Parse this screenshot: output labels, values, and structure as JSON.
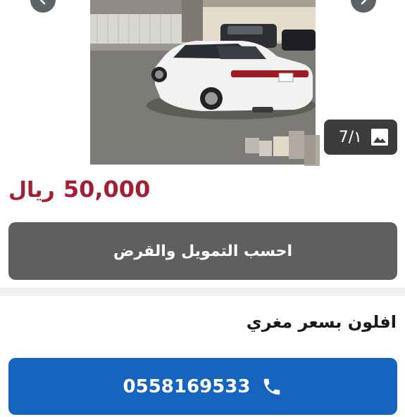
{
  "listing": {
    "price_amount": "50,000",
    "price_currency": "ريال",
    "finance_button_label": "احسب التمويل والقرض",
    "title": "افلون بسعر مغري",
    "phone": "0558169533"
  },
  "gallery": {
    "counter": "7/۱",
    "icons": {
      "prev": "chevron-left-icon",
      "next": "chevron-right-icon",
      "photos": "image-icon",
      "phone": "phone-icon"
    }
  },
  "colors": {
    "price": "#a31f34",
    "finance_button": "#5f5f5f",
    "call_button": "#1565c0",
    "counter_badge": "#3c3c3c",
    "divider": "#f0f1f3"
  }
}
